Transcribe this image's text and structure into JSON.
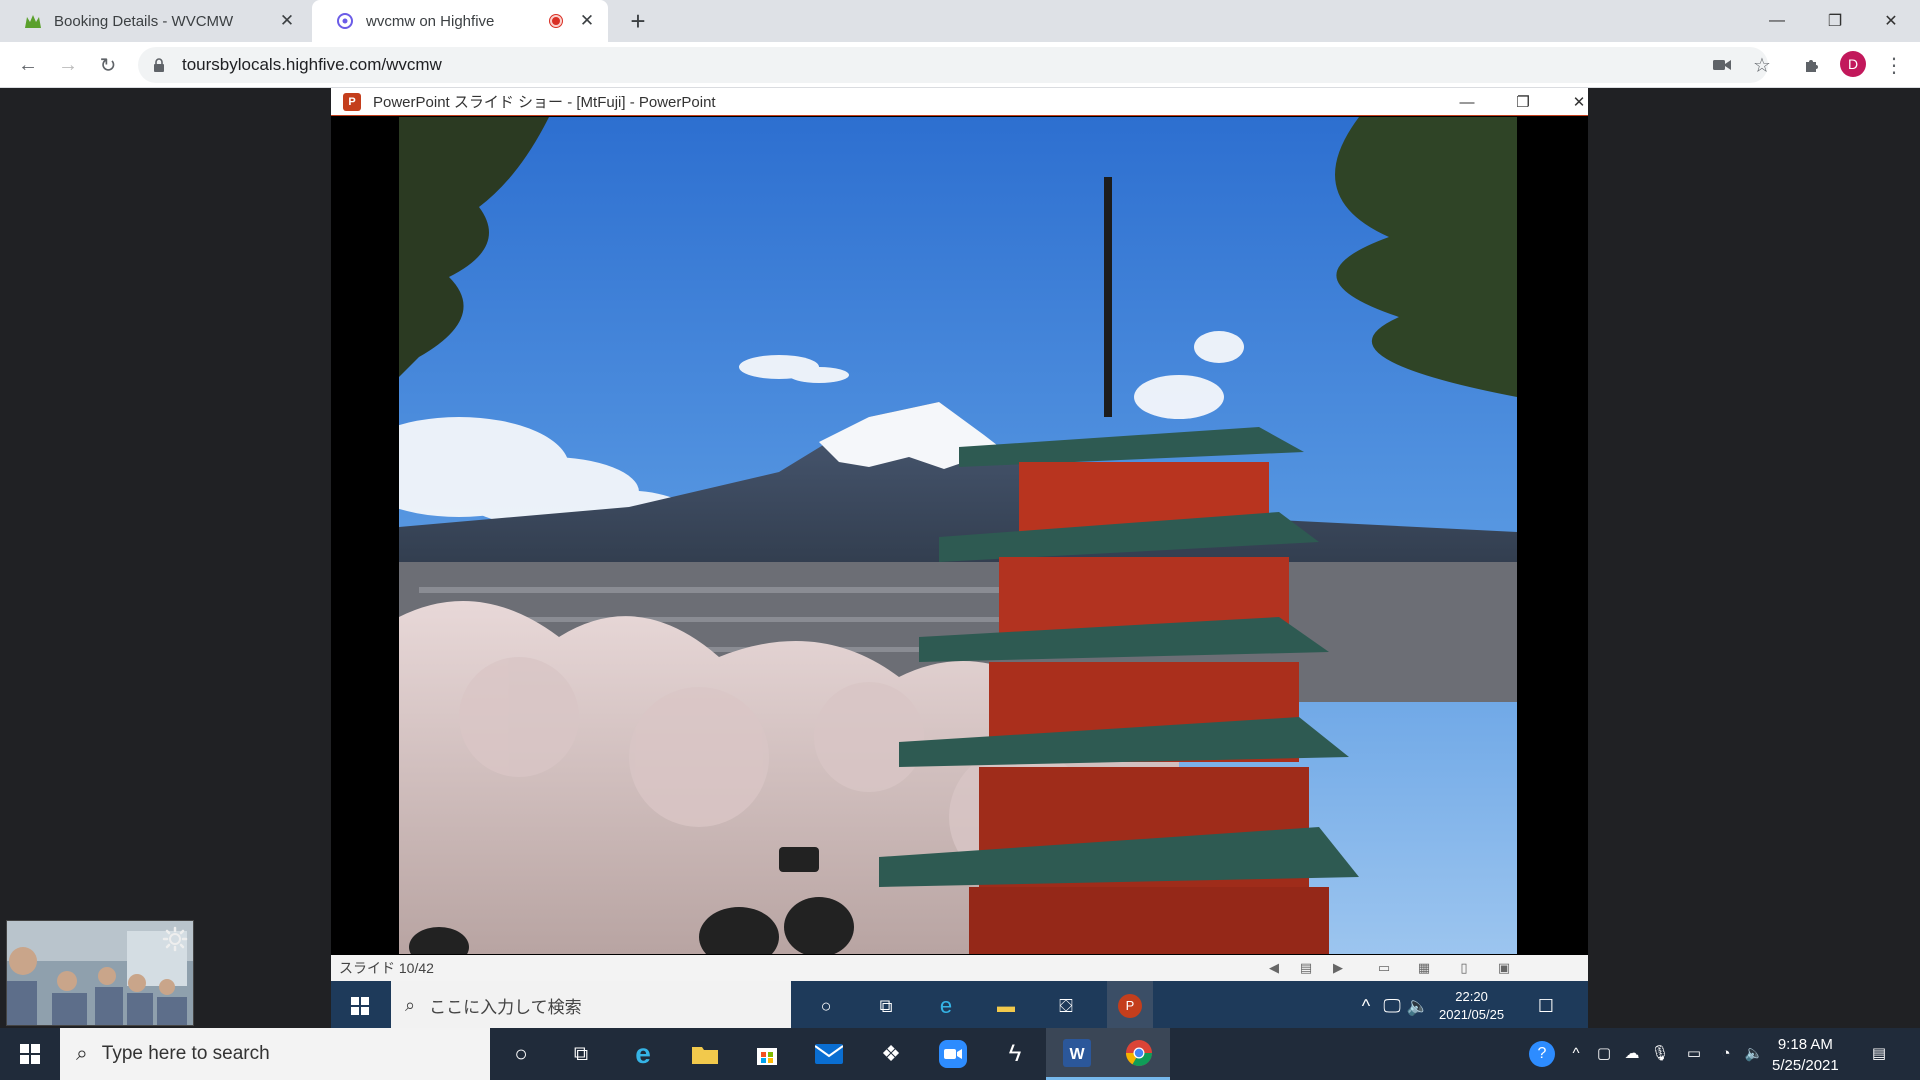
{
  "browser": {
    "tabs": [
      {
        "title": "Booking Details - WVCMW",
        "icon": "toursbylocals-icon"
      },
      {
        "title": "wvcmw on Highfive",
        "icon": "highfive-icon",
        "recording": true
      }
    ],
    "url": "toursbylocals.highfive.com/wvcmw",
    "profile_initial": "D",
    "accent": "#c2185b"
  },
  "powerpoint": {
    "window_title": "PowerPoint スライド ショー - [MtFuji] - PowerPoint",
    "status_slide": "スライド 10/42",
    "accent": "#c43e1c"
  },
  "inner_taskbar": {
    "search_placeholder": "ここに入力して検索",
    "time": "22:20",
    "date": "2021/05/25"
  },
  "taskbar": {
    "search_placeholder": "Type here to search",
    "time": "9:18 AM",
    "date": "5/25/2021"
  }
}
